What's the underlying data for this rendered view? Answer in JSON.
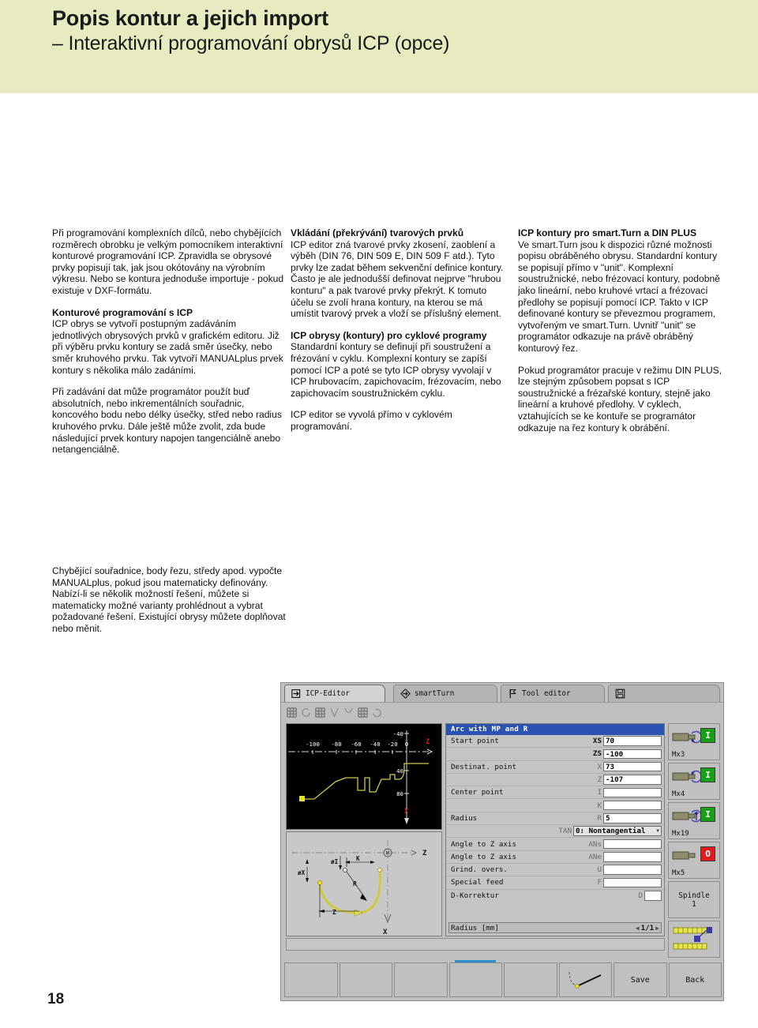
{
  "header": {
    "title_main": "Popis kontur a jejich import",
    "title_sub": "– Interaktivní programování obrysů ICP (opce)",
    "band_color": "#e8ebc0"
  },
  "page_number": "18",
  "columns": {
    "col1": {
      "p1": "Při programování komplexních dílců, nebo chybějících rozměrech obrobku je velkým pomocníkem interaktivní konturové programování ICP. Zpravidla se obrysové prvky popisují tak, jak jsou okótovány na výrobním výkresu. Nebo se kontura jednoduše importuje - pokud existuje v DXF-formátu.",
      "h2": "Konturové programování s ICP",
      "p2": "ICP obrys se vytvoří postupným zadáváním jednotlivých obrysových prvků v grafickém editoru. Již při výběru prvku kontury se zadá směr úsečky, nebo směr kruhového prvku. Tak vytvoří MANUALplus prvek kontury s několika málo zadáními.",
      "p3": "Při zadávání dat může programátor použít buď absolutních, nebo inkrementálních souřadnic, koncového bodu nebo délky úsečky, střed nebo radius kruhového prvku. Dále ještě může zvolit, zda bude následující prvek kontury napojen tangenciálně anebo netangenciálně.",
      "p4": "Chybějící souřadnice, body řezu, středy apod. vypočte MANUALplus, pokud jsou matematicky definovány. Nabízí-li se několik možností řešení, můžete si matematicky možné varianty prohlédnout a vybrat požadované řešení. Existující obrysy můžete doplňovat nebo měnit."
    },
    "col2": {
      "h1": "Vkládání (překrývání) tvarových prvků",
      "p1": "ICP editor zná tvarové prvky zkosení, zaoblení a výběh (DIN 76, DIN 509 E, DIN 509 F atd.). Tyto prvky lze zadat během sekvenční definice kontury. Často je ale jednodušší definovat nejprve \"hrubou konturu\" a pak tvarové prvky překrýt. K tomuto účelu se zvolí hrana kontury, na kterou se má umístit tvarový prvek a vloží se příslušný element.",
      "h2": "ICP obrysy (kontury) pro cyklové programy",
      "p2": "Standardní kontury se definují při soustružení a frézování v cyklu. Komplexní kontury se zapíší pomocí ICP a poté se tyto ICP obrysy vyvolají v ICP hrubovacím, zapichovacím, frézovacím, nebo zapichovacím soustružnickém cyklu.",
      "p3": "ICP editor se vyvolá přímo v cyklovém programování."
    },
    "col3": {
      "h1": "ICP kontury pro smart.Turn a DIN PLUS",
      "p1": "Ve smart.Turn jsou k dispozici různé možnosti popisu obráběného obrysu. Standardní kontury se popisují přímo v \"unit\". Komplexní soustružnické, nebo frézovací kontury, podobně jako lineární, nebo kruhové vrtací a frézovací předlohy se popisují pomocí ICP. Takto v ICP definované kontury se převezmou programem, vytvořeným ve smart.Turn. Uvnitř \"unit\" se programátor odkazuje na právě obráběný konturový řez.",
      "p2": "Pokud programátor pracuje v režimu DIN PLUS, lze stejným způsobem popsat s ICP soustružnické a frézařské kontury, stejně jako lineární a kruhové předlohy. V cyklech, vztahujících se ke kontuře se programátor odkazuje na řez kontury k obrábění."
    }
  },
  "cnc": {
    "tabs": [
      {
        "label": "ICP-Editor",
        "icon": "arrow-into-box-icon",
        "active": true
      },
      {
        "label": "smartTurn",
        "icon": "diamond-arrow-icon",
        "active": false
      },
      {
        "label": "Tool editor",
        "icon": "tool-flag-icon",
        "active": false
      },
      {
        "label": "",
        "icon": "floppy-disk-icon",
        "active": false
      }
    ],
    "toolbar_icons": [
      "grid-icon",
      "rotate-cw-icon",
      "grid-icon",
      "angle-icon",
      "arc-icon",
      "grid-icon",
      "undo-icon"
    ],
    "graphic": {
      "z_ticks": [
        "-100",
        "-80",
        "-60",
        "-40",
        "-20",
        "0"
      ],
      "x_ticks": [
        "-40",
        "0",
        "40",
        "80"
      ],
      "axis_z_label": "Z",
      "axis_x_label": "X",
      "contour_color": "#cbc94a"
    },
    "help_graphic": {
      "labels": [
        "øI",
        "K",
        "øX",
        "R",
        "Z",
        "Z",
        "X"
      ],
      "arc_color": "#cfcc40"
    },
    "dialog": {
      "title": "Arc with MP and R",
      "rows": [
        {
          "label": "Start point",
          "code": "XS",
          "value": "70",
          "width": "wide",
          "dim": false
        },
        {
          "label": "",
          "code": "ZS",
          "value": "-100",
          "width": "wide",
          "dim": false
        },
        {
          "label": "Destinat. point",
          "code": "X",
          "value": "73",
          "width": "wide",
          "dim": true
        },
        {
          "label": "",
          "code": "Z",
          "value": "-107",
          "width": "wide",
          "dim": true
        },
        {
          "label": "Center point",
          "code": "I",
          "value": "",
          "width": "wide",
          "dim": true
        },
        {
          "label": "",
          "code": "K",
          "value": "",
          "width": "wide",
          "dim": true
        },
        {
          "label": "Radius",
          "code": "R",
          "value": "5",
          "width": "wide",
          "dim": true
        },
        {
          "label": "Angle to Z axis",
          "code": "ANs",
          "value": "",
          "width": "wide",
          "dim": true
        },
        {
          "label": "Angle to Z axis",
          "code": "ANe",
          "value": "",
          "width": "wide",
          "dim": true
        },
        {
          "label": "Grind. overs.",
          "code": "U",
          "value": "",
          "width": "wide",
          "dim": true
        },
        {
          "label": "Special feed",
          "code": "F",
          "value": "",
          "width": "wide",
          "dim": true
        },
        {
          "label": "D-Korrektur",
          "code": "D",
          "value": "",
          "width": "narrow",
          "dim": true
        }
      ],
      "select": {
        "code": "TAN",
        "value": "0: Nontangential"
      },
      "status_text": "Radius [mm]",
      "status_pager": "1/1",
      "title_bg": "#2a52b0"
    },
    "side_buttons": [
      {
        "label": "Mx3",
        "lamp": "I",
        "lamp_color": "green",
        "icon": "spindle-cw-icon"
      },
      {
        "label": "Mx4",
        "lamp": "I",
        "lamp_color": "green",
        "icon": "spindle-ccw-icon"
      },
      {
        "label": "Mx19",
        "lamp": "I",
        "lamp_color": "green",
        "icon": "spindle-orient-icon"
      },
      {
        "label": "Mx5",
        "lamp": "O",
        "lamp_color": "red",
        "icon": "spindle-stop-icon"
      }
    ],
    "spindle_button": {
      "line1": "Spindle",
      "line2": "1"
    },
    "tool_button_icon": "tool-carrier-icon",
    "softkeys": [
      {
        "label": "",
        "icon": "",
        "marked": false
      },
      {
        "label": "",
        "icon": "",
        "marked": false
      },
      {
        "label": "",
        "icon": "",
        "marked": false
      },
      {
        "label": "",
        "icon": "",
        "marked": true
      },
      {
        "label": "",
        "icon": "",
        "marked": false
      },
      {
        "label": "",
        "icon": "contour-sketch-icon",
        "marked": false
      },
      {
        "label": "Save",
        "icon": "",
        "marked": false
      },
      {
        "label": "Back",
        "icon": "",
        "marked": false
      }
    ]
  }
}
